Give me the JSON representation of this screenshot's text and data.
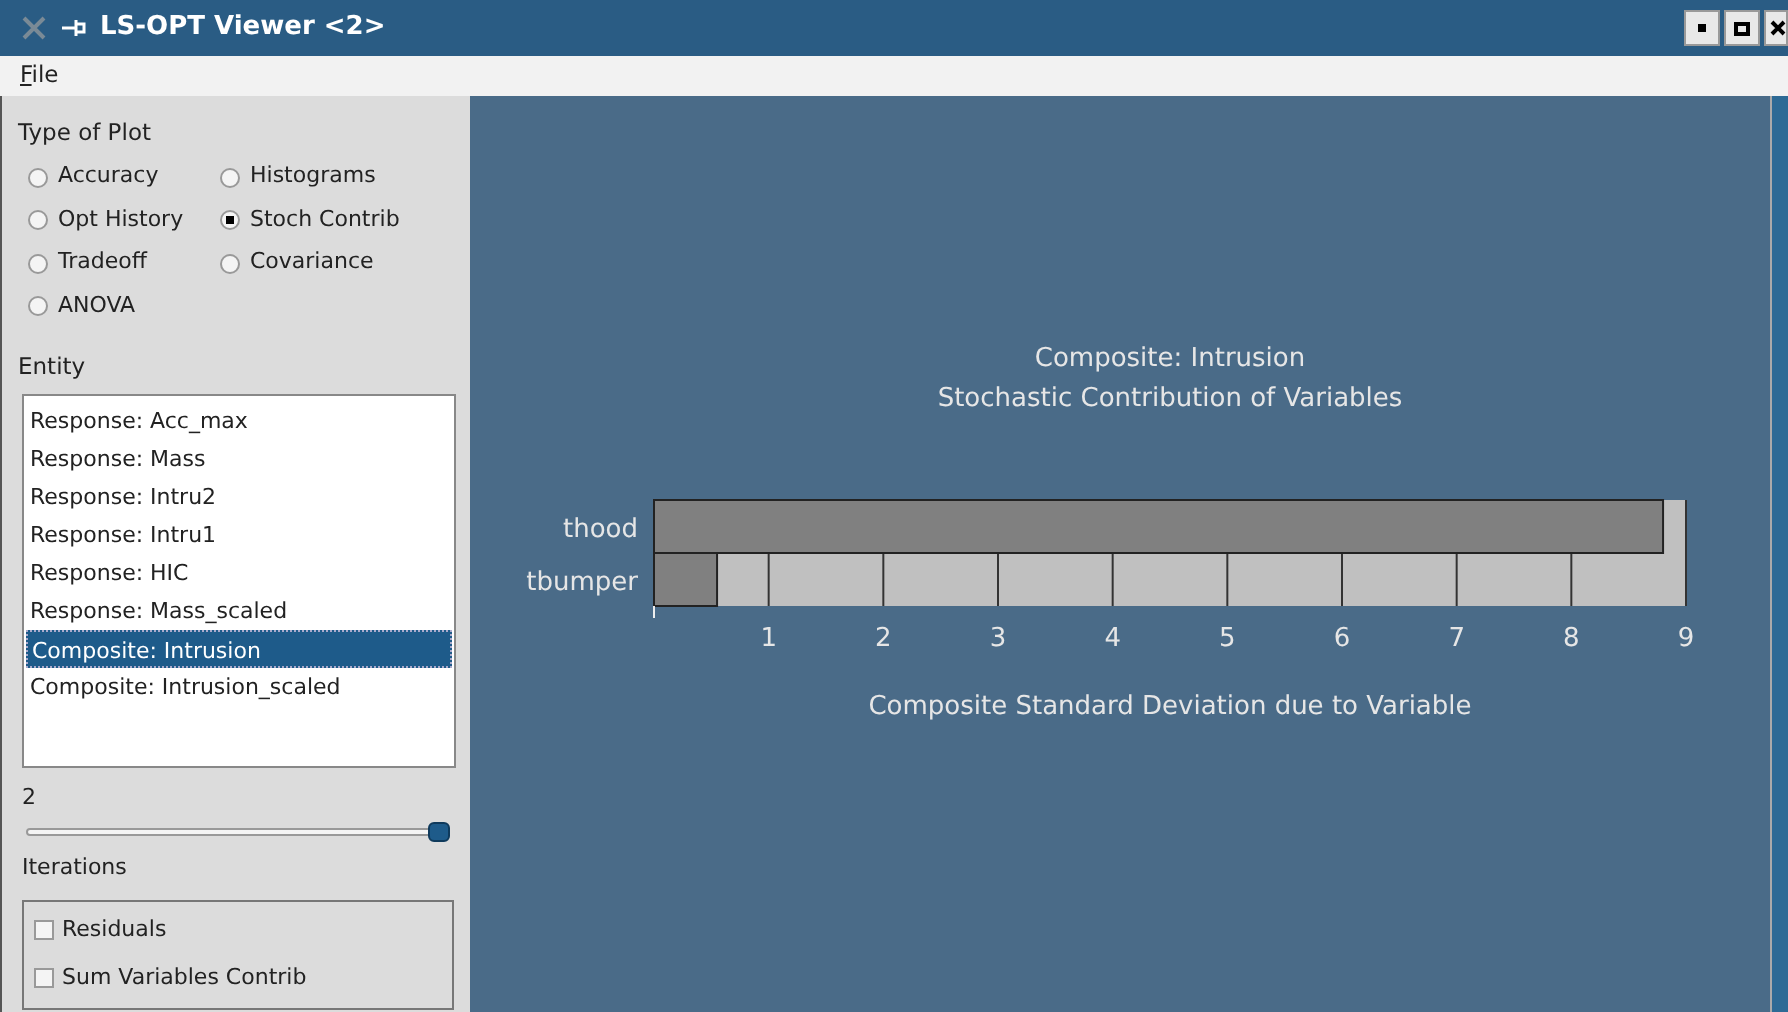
{
  "window": {
    "title": "LS-OPT Viewer <2>"
  },
  "menu": [
    {
      "label": "File"
    }
  ],
  "type_of_plot": {
    "title": "Type of Plot",
    "options": [
      {
        "label": "Accuracy",
        "selected": false
      },
      {
        "label": "Histograms",
        "selected": false
      },
      {
        "label": "Opt History",
        "selected": false
      },
      {
        "label": "Stoch Contrib",
        "selected": true
      },
      {
        "label": "Tradeoff",
        "selected": false
      },
      {
        "label": "Covariance",
        "selected": false
      },
      {
        "label": "ANOVA",
        "selected": false
      }
    ]
  },
  "entity": {
    "title": "Entity",
    "items": [
      {
        "label": "Response: Acc_max",
        "selected": false
      },
      {
        "label": "Response: Mass",
        "selected": false
      },
      {
        "label": "Response: Intru2",
        "selected": false
      },
      {
        "label": "Response: Intru1",
        "selected": false
      },
      {
        "label": "Response: HIC",
        "selected": false
      },
      {
        "label": "Response: Mass_scaled",
        "selected": false
      },
      {
        "label": "Composite: Intrusion",
        "selected": true
      },
      {
        "label": "Composite: Intrusion_scaled",
        "selected": false
      }
    ]
  },
  "iterations": {
    "reading": "2",
    "level": 1,
    "label": "Iterations"
  },
  "options": [
    {
      "label": "Residuals",
      "checked": false
    },
    {
      "label": "Sum Variables Contrib",
      "checked": false
    }
  ],
  "plot": {
    "chart_data": {
      "type": "bar",
      "orientation": "horizontal",
      "title": "Composite: Intrusion\nStochastic Contribution of Variables",
      "xlabel": "Composite Standard Deviation due to Variable",
      "categories": [
        "thood",
        "tbumper"
      ],
      "values": [
        8.8,
        0.55
      ],
      "xlim": [
        0,
        9
      ],
      "grid": true,
      "xticks": [
        1,
        2,
        3,
        4,
        5,
        6,
        7,
        8,
        9
      ]
    }
  }
}
